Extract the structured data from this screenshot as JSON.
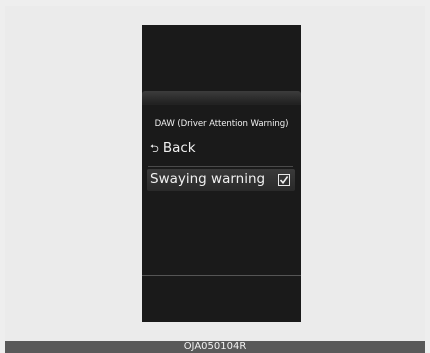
{
  "cluster": {
    "menu_title": "DAW (Driver Attention Warning)",
    "back_item": {
      "icon": "back-arrow-icon",
      "label": "Back"
    },
    "sway_item": {
      "label": "Swaying warning",
      "checked": true,
      "icon": "checkbox-checked-icon"
    }
  },
  "caption": "OJA050104R"
}
